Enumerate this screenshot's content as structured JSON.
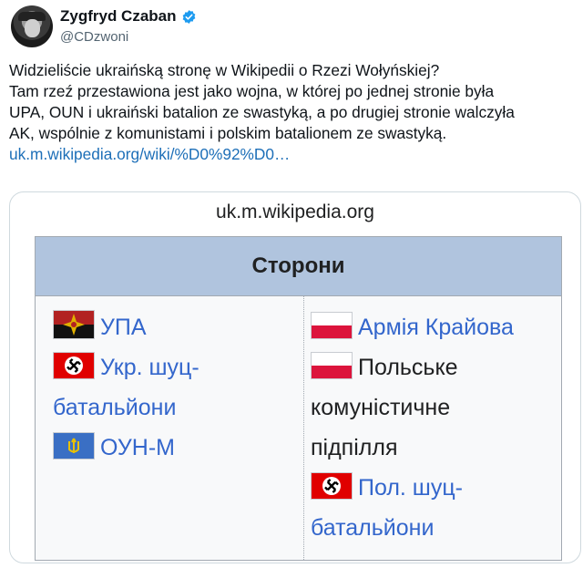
{
  "author": {
    "name": "Zygfryd Czaban",
    "handle": "@CDzwoni"
  },
  "tweet": {
    "lines": [
      "Widzieliście ukraińską stronę w Wikipedii o Rzezi Wołyńskiej?",
      "Tam rzeź przestawiona jest jako wojna, w której po jednej stronie była",
      "UPA, OUN i ukraiński batalion ze swastyką, a po drugiej stronie walczyła",
      "AK, wspólnie z komunistami i polskim batalionem ze swastyką."
    ],
    "link": "uk.m.wikipedia.org/wiki/%D0%92%D0…"
  },
  "card": {
    "domain": "uk.m.wikipedia.org",
    "header": "Сторони",
    "left": {
      "upa": "УПА",
      "shuc_line1": "Укр. шуц-",
      "shuc_line2": "батальйони",
      "oun": "ОУН-М"
    },
    "right": {
      "ak": "Армія Крайова",
      "communist_line1": "Польське",
      "communist_line2": "комуністичне",
      "communist_line3": "підпілля",
      "shuc_line1": "Пол. шуц-",
      "shuc_line2": "батальйони"
    },
    "flags": {
      "upa": "upa-emblem-icon",
      "nazi": "swastika-flag-icon",
      "oun": "oun-flag-icon",
      "poland": "poland-flag-icon"
    }
  },
  "colors": {
    "link": "#1d6fb8",
    "wiki_link": "#3366cc",
    "verified": "#1d9bf0",
    "infobox_header": "#b0c4de"
  }
}
